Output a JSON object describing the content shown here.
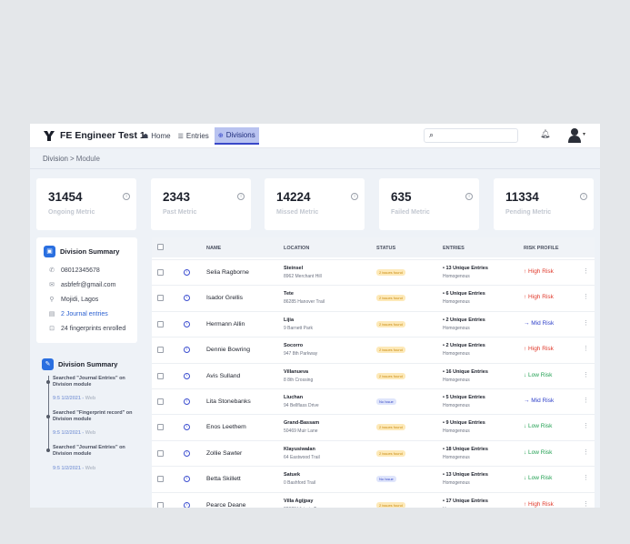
{
  "app": {
    "title": "FE Engineer Test 1"
  },
  "nav": [
    {
      "label": "Home",
      "icon": "home-icon",
      "active": false
    },
    {
      "label": "Entries",
      "icon": "entries-icon",
      "active": false
    },
    {
      "label": "Divisions",
      "icon": "divisions-icon",
      "active": true
    }
  ],
  "search": {
    "placeholder": "",
    "icon": "search-icon"
  },
  "breadcrumb": {
    "parent": "Division",
    "separator": ">",
    "current": "Module"
  },
  "metrics": [
    {
      "value": "31454",
      "label": "Ongoing Metric"
    },
    {
      "value": "2343",
      "label": "Past Metric"
    },
    {
      "value": "14224",
      "label": "Missed Metric"
    },
    {
      "value": "635",
      "label": "Failed Metric"
    },
    {
      "value": "11334",
      "label": "Pending Metric"
    }
  ],
  "division_summary": {
    "title": "Division Summary",
    "phone": "08012345678",
    "email": "asbfefr@gmail.com",
    "location": "Mojidi, Lagos",
    "journal_entries": "2 Journal entries",
    "fingerprints": "24 fingerprints enrolled"
  },
  "activity": {
    "title": "Division Summary",
    "items": [
      {
        "text": "Searched \"Journal Entries\" on Division module",
        "date": "9:5 1/2/2021",
        "source": "Web"
      },
      {
        "text": "Searched \"Fingerprint record\" on Division module",
        "date": "9:5 1/2/2021",
        "source": "Web"
      },
      {
        "text": "Searched \"Journal Entries\" on Division module",
        "date": "9:5 1/2/2021",
        "source": "Web"
      }
    ]
  },
  "table": {
    "columns": [
      "NAME",
      "LOCATION",
      "STATUS",
      "ENTRIES",
      "RISK PROFILE"
    ],
    "rows": [
      {
        "name": "Selia Ragborne",
        "loc1": "Steinsel",
        "loc2": "8962 Merchant Hill",
        "status": "2 issues found",
        "status_type": "issues",
        "ent1": "• 13 Unique Entries",
        "ent2": "Homogenous",
        "risk": "↑ High Risk",
        "risk_type": "high"
      },
      {
        "name": "Isador Grellis",
        "loc1": "Tete",
        "loc2": "86285 Hanover Trail",
        "status": "2 issues found",
        "status_type": "issues",
        "ent1": "• 6 Unique Entries",
        "ent2": "Homogenous",
        "risk": "↑ High Risk",
        "risk_type": "high"
      },
      {
        "name": "Hermann Allin",
        "loc1": "Lijia",
        "loc2": "9 Barnett Park",
        "status": "2 issues found",
        "status_type": "issues",
        "ent1": "• 2 Unique Entries",
        "ent2": "Homogenous",
        "risk": "→ Mid Risk",
        "risk_type": "mid"
      },
      {
        "name": "Dennie Bowring",
        "loc1": "Socorro",
        "loc2": "947 8th Parkway",
        "status": "2 issues found",
        "status_type": "issues",
        "ent1": "• 2 Unique Entries",
        "ent2": "Homogenous",
        "risk": "↑ High Risk",
        "risk_type": "high"
      },
      {
        "name": "Avis Sulland",
        "loc1": "Villanueva",
        "loc2": "8 8th Crossing",
        "status": "2 issues found",
        "status_type": "issues",
        "ent1": "• 16 Unique Entries",
        "ent2": "Homogenous",
        "risk": "↓ Low Risk",
        "risk_type": "low"
      },
      {
        "name": "Lita Stonebanks",
        "loc1": "Liuchan",
        "loc2": "94 Bellflass Drive",
        "status": "No Issue",
        "status_type": "none",
        "ent1": "• 5 Unique Entries",
        "ent2": "Homogenous",
        "risk": "→ Mid Risk",
        "risk_type": "mid"
      },
      {
        "name": "Enos Leethem",
        "loc1": "Grand-Bassam",
        "loc2": "50469 Muir Lane",
        "status": "2 issues found",
        "status_type": "issues",
        "ent1": "• 9 Unique Entries",
        "ent2": "Homogenous",
        "risk": "↓ Low Risk",
        "risk_type": "low"
      },
      {
        "name": "Zollie Sawter",
        "loc1": "Klayusiwalan",
        "loc2": "64 Eastwood Trail",
        "status": "2 issues found",
        "status_type": "issues",
        "ent1": "• 18 Unique Entries",
        "ent2": "Homogenous",
        "risk": "↓ Low Risk",
        "risk_type": "low"
      },
      {
        "name": "Betta Skillett",
        "loc1": "Satuek",
        "loc2": "0 Bashford Trail",
        "status": "No Issue",
        "status_type": "none",
        "ent1": "• 13 Unique Entries",
        "ent2": "Homogenous",
        "risk": "↓ Low Risk",
        "risk_type": "low"
      },
      {
        "name": "Pearce Deane",
        "loc1": "Villa Agijpay",
        "loc2": "22023 Victoria Terrace",
        "status": "2 issues found",
        "status_type": "issues",
        "ent1": "• 17 Unique Entries",
        "ent2": "Homogenous",
        "risk": "↑ High Risk",
        "risk_type": "high"
      }
    ]
  },
  "colors": {
    "accent": "#3948c8",
    "high": "#e0392b",
    "mid": "#2d3fc9",
    "low": "#22a052"
  }
}
